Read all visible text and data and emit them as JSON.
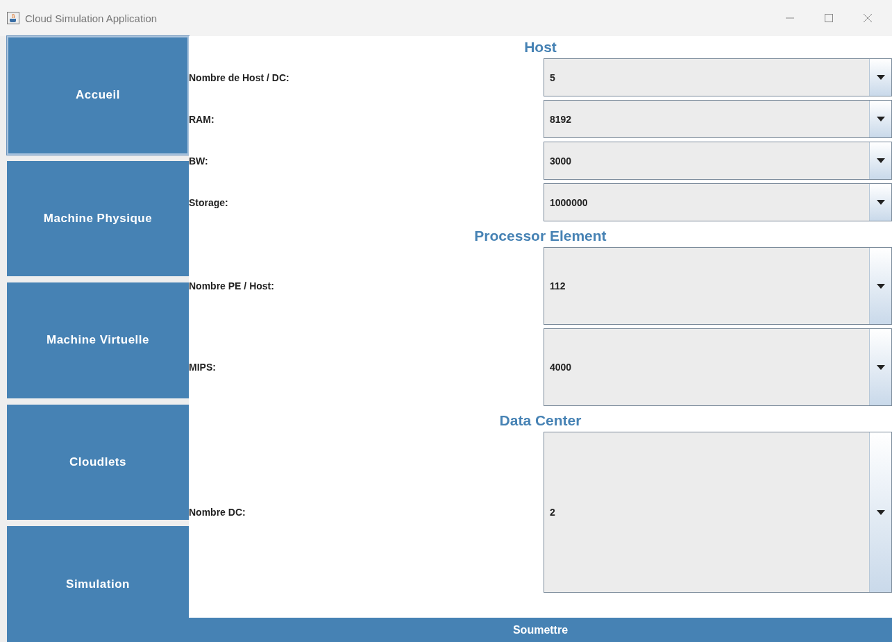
{
  "window": {
    "title": "Cloud Simulation Application"
  },
  "sidebar": {
    "items": [
      {
        "label": "Accueil",
        "selected": true
      },
      {
        "label": "Machine Physique",
        "selected": false
      },
      {
        "label": "Machine Virtuelle",
        "selected": false
      },
      {
        "label": "Cloudlets",
        "selected": false
      },
      {
        "label": "Simulation",
        "selected": false
      }
    ]
  },
  "sections": [
    {
      "title": "Host",
      "fields": [
        {
          "label": "Nombre de Host / DC:",
          "value": "5"
        },
        {
          "label": "RAM:",
          "value": "8192"
        },
        {
          "label": "BW:",
          "value": "3000"
        },
        {
          "label": "Storage:",
          "value": "1000000"
        }
      ]
    },
    {
      "title": "Processor Element",
      "fields": [
        {
          "label": "Nombre PE / Host:",
          "value": "112"
        },
        {
          "label": "MIPS:",
          "value": "4000"
        }
      ]
    },
    {
      "title": "Data Center",
      "fields": [
        {
          "label": "Nombre DC:",
          "value": "2"
        }
      ]
    }
  ],
  "submit_button": "Soumettre"
}
